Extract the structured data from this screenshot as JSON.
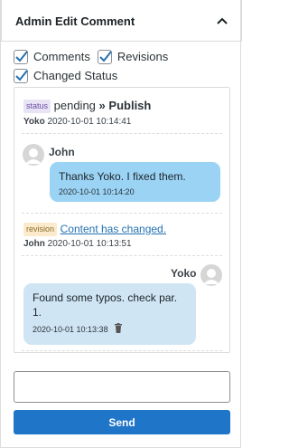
{
  "header": {
    "title": "Admin Edit Comment",
    "toggle_icon": "chevron-up-icon"
  },
  "filters": [
    {
      "label": "Comments",
      "checked": true
    },
    {
      "label": "Revisions",
      "checked": true
    },
    {
      "label": "Changed Status",
      "checked": true
    }
  ],
  "thread": {
    "status_entry": {
      "badge": "status",
      "from": "pending",
      "arrow": "»",
      "to": "Publish",
      "author": "Yoko",
      "time": "2020-10-01 10:14:41"
    },
    "message_john": {
      "author": "John",
      "text": "Thanks Yoko. I fixed them.",
      "time": "2020-10-01 10:14:20"
    },
    "revision_entry": {
      "badge": "revision",
      "link": "Content has changed.",
      "author": "John",
      "time": "2020-10-01 10:13:51"
    },
    "message_yoko": {
      "author": "Yoko",
      "text": "Found some typos. check par. 1.",
      "time": "2020-10-01 10:13:38",
      "delete_icon": "trash-icon"
    }
  },
  "reply": {
    "value": "",
    "placeholder": ""
  },
  "send_label": "Send",
  "colors": {
    "accent": "#1f75c8",
    "bubble_outgoing": "#9bd3f5",
    "bubble_incoming": "#cfe5f4",
    "link": "#2271b1"
  }
}
